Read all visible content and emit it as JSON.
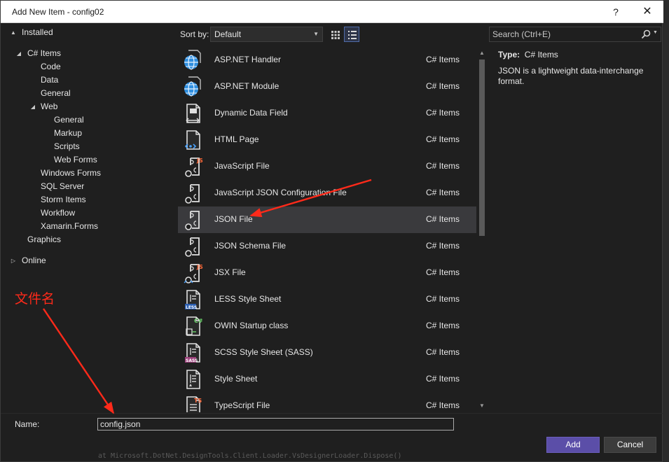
{
  "window": {
    "title": "Add New Item - config02",
    "help_label": "?",
    "close_label": "✕"
  },
  "tree": {
    "items": [
      {
        "label": "Installed",
        "toggle": "▲",
        "level": 0
      },
      {
        "label": "C# Items",
        "toggle": "◢",
        "level": 1
      },
      {
        "label": "Code",
        "level": 2
      },
      {
        "label": "Data",
        "level": 2
      },
      {
        "label": "General",
        "level": 2
      },
      {
        "label": "Web",
        "toggle": "◢",
        "level": 2
      },
      {
        "label": "General",
        "level": 3
      },
      {
        "label": "Markup",
        "level": 3
      },
      {
        "label": "Scripts",
        "level": 3
      },
      {
        "label": "Web Forms",
        "level": 3
      },
      {
        "label": "Windows Forms",
        "level": 2
      },
      {
        "label": "SQL Server",
        "level": 2
      },
      {
        "label": "Storm Items",
        "level": 2
      },
      {
        "label": "Workflow",
        "level": 2
      },
      {
        "label": "Xamarin.Forms",
        "level": 2
      },
      {
        "label": "Graphics",
        "level": 1
      },
      {
        "label": "Online",
        "toggle": "▷",
        "level": 0
      }
    ]
  },
  "toolbar": {
    "sort_label": "Sort by:",
    "sort_value": "Default",
    "sort_arrow": "▼"
  },
  "items": [
    {
      "name": "ASP.NET Handler",
      "category": "C# Items",
      "icon": "globe-icon"
    },
    {
      "name": "ASP.NET Module",
      "category": "C# Items",
      "icon": "globe-icon"
    },
    {
      "name": "Dynamic Data Field",
      "category": "C# Items",
      "icon": "data-field-icon"
    },
    {
      "name": "HTML Page",
      "category": "C# Items",
      "icon": "html-page-icon"
    },
    {
      "name": "JavaScript File",
      "category": "C# Items",
      "icon": "js-file-icon"
    },
    {
      "name": "JavaScript JSON Configuration File",
      "category": "C# Items",
      "icon": "json-file-icon"
    },
    {
      "name": "JSON File",
      "category": "C# Items",
      "icon": "json-file-icon",
      "selected": true
    },
    {
      "name": "JSON Schema File",
      "category": "C# Items",
      "icon": "json-file-icon"
    },
    {
      "name": "JSX File",
      "category": "C# Items",
      "icon": "jsx-file-icon"
    },
    {
      "name": "LESS Style Sheet",
      "category": "C# Items",
      "icon": "less-file-icon"
    },
    {
      "name": "OWIN Startup class",
      "category": "C# Items",
      "icon": "csharp-class-icon"
    },
    {
      "name": "SCSS Style Sheet (SASS)",
      "category": "C# Items",
      "icon": "scss-file-icon"
    },
    {
      "name": "Style Sheet",
      "category": "C# Items",
      "icon": "stylesheet-icon"
    },
    {
      "name": "TypeScript File",
      "category": "C# Items",
      "icon": "ts-file-icon"
    }
  ],
  "search": {
    "placeholder": "Search (Ctrl+E)"
  },
  "description": {
    "type_label": "Type:",
    "type_value": "C# Items",
    "text": "JSON is a lightweight data-interchange format."
  },
  "name_field": {
    "label": "Name:",
    "value": "config.json"
  },
  "buttons": {
    "add": "Add",
    "cancel": "Cancel"
  },
  "annotation": {
    "text": "文件名",
    "color": "#ff2a1a"
  },
  "background_text": "at Microsoft.DotNet.DesignTools.Client.Loader.VsDesignerLoader.Dispose()",
  "colors": {
    "accent": "#5b4ea8",
    "selected_row": "#3a3a3d",
    "globe": "#2f8fe0"
  }
}
